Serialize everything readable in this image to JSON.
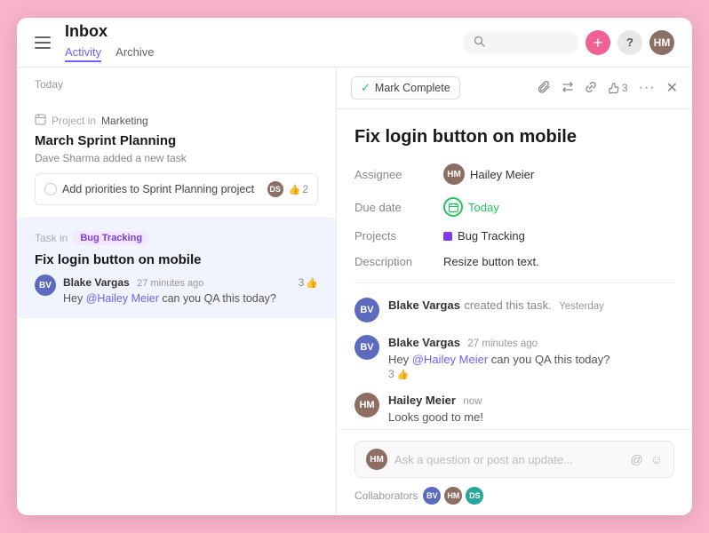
{
  "topbar": {
    "title": "Inbox",
    "tabs": [
      {
        "label": "Activity",
        "active": true
      },
      {
        "label": "Archive",
        "active": false
      }
    ],
    "search_placeholder": "",
    "add_btn_label": "+",
    "help_btn_label": "?",
    "avatar_initials": "HM"
  },
  "left_panel": {
    "section_label": "Today",
    "items": [
      {
        "id": "item1",
        "context": "Project in",
        "project_name": "Marketing",
        "title": "March Sprint Planning",
        "subtitle": "Dave Sharma added a new task",
        "task_text": "Add priorities to Sprint Planning project",
        "task_assignee_initials": "DS",
        "task_likes": "2"
      },
      {
        "id": "item2",
        "context": "Task in",
        "tag_label": "Bug Tracking",
        "title": "Fix login button on mobile",
        "active": true,
        "comment_author": "Blake Vargas",
        "comment_author_initials": "BV",
        "comment_time": "27 minutes ago",
        "comment_likes": "3",
        "comment_text": "Hey ",
        "comment_mention": "@Hailey Meier",
        "comment_text2": " can you QA this today?"
      }
    ]
  },
  "right_panel": {
    "mark_complete_label": "Mark Complete",
    "task_title": "Fix login button on mobile",
    "assignee_label": "Assignee",
    "assignee_name": "Hailey Meier",
    "assignee_initials": "HM",
    "due_date_label": "Due date",
    "due_date_value": "Today",
    "projects_label": "Projects",
    "project_name": "Bug Tracking",
    "description_label": "Description",
    "description_value": "Resize button text.",
    "activity": [
      {
        "id": "act1",
        "author": "Blake Vargas",
        "author_initials": "BV",
        "time": "Yesterday",
        "system_text": "created this task.",
        "type": "system"
      },
      {
        "id": "act2",
        "author": "Blake Vargas",
        "author_initials": "BV",
        "time": "27 minutes ago",
        "text": "Hey ",
        "mention": "@Hailey Meier",
        "text2": " can you QA this today?",
        "likes": "3",
        "type": "comment"
      },
      {
        "id": "act3",
        "author": "Hailey Meier",
        "author_initials": "HM",
        "time": "now",
        "text": "Looks good to me!",
        "type": "comment"
      }
    ],
    "reply_placeholder": "Ask a question or post an update...",
    "collaborators_label": "Collaborators",
    "collaborators": [
      {
        "initials": "BV",
        "color": "#5c6bc0"
      },
      {
        "initials": "HM",
        "color": "#8d6e63"
      },
      {
        "initials": "DS",
        "color": "#26a69a"
      }
    ]
  },
  "icons": {
    "hamburger": "☰",
    "search": "🔍",
    "check": "✓",
    "paperclip": "📎",
    "repeat": "↺",
    "link": "🔗",
    "thumb": "👍",
    "more": "•••",
    "close": "✕",
    "calendar": "⊙",
    "at": "@",
    "emoji": "☺"
  }
}
